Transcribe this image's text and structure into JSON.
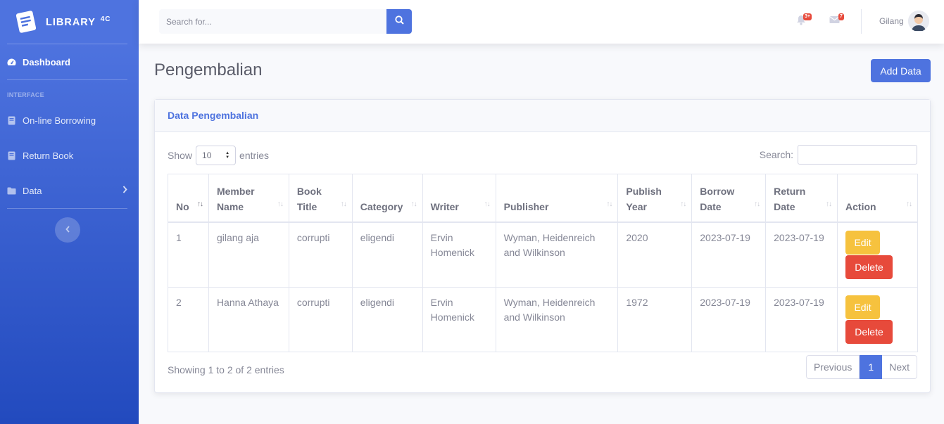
{
  "brand": {
    "name": "LIBRARY",
    "suffix": "4C"
  },
  "sidebar": {
    "dashboard": "Dashboard",
    "heading": "INTERFACE",
    "items": [
      {
        "label": "On-line Borrowing",
        "icon": "book-icon"
      },
      {
        "label": "Return Book",
        "icon": "book-icon"
      },
      {
        "label": "Data",
        "icon": "folder-icon"
      }
    ]
  },
  "topbar": {
    "search_placeholder": "Search for...",
    "alerts_badge": "3+",
    "messages_badge": "7",
    "user_name": "Gilang"
  },
  "page": {
    "title": "Pengembalian",
    "add_button": "Add Data"
  },
  "card": {
    "title": "Data Pengembalian"
  },
  "datatable": {
    "show_label": "Show",
    "entries_value": "10",
    "entries_label": "entries",
    "search_label": "Search:",
    "columns": [
      "No",
      "Member Name",
      "Book Title",
      "Category",
      "Writer",
      "Publisher",
      "Publish Year",
      "Borrow Date",
      "Return Date",
      "Action"
    ],
    "rows": [
      {
        "no": "1",
        "member": "gilang aja",
        "title": "corrupti",
        "category": "eligendi",
        "writer": "Ervin Homenick",
        "publisher": "Wyman, Heidenreich and Wilkinson",
        "year": "2020",
        "borrow": "2023-07-19",
        "return": "2023-07-19"
      },
      {
        "no": "2",
        "member": "Hanna Athaya",
        "title": "corrupti",
        "category": "eligendi",
        "writer": "Ervin Homenick",
        "publisher": "Wyman, Heidenreich and Wilkinson",
        "year": "1972",
        "borrow": "2023-07-19",
        "return": "2023-07-19"
      }
    ],
    "edit_label": "Edit",
    "delete_label": "Delete",
    "info": "Showing 1 to 2 of 2 entries",
    "pagination": {
      "previous": "Previous",
      "current": "1",
      "next": "Next"
    }
  },
  "colors": {
    "primary": "#4e73df",
    "warning": "#f6c23e",
    "danger": "#e74a3b"
  }
}
